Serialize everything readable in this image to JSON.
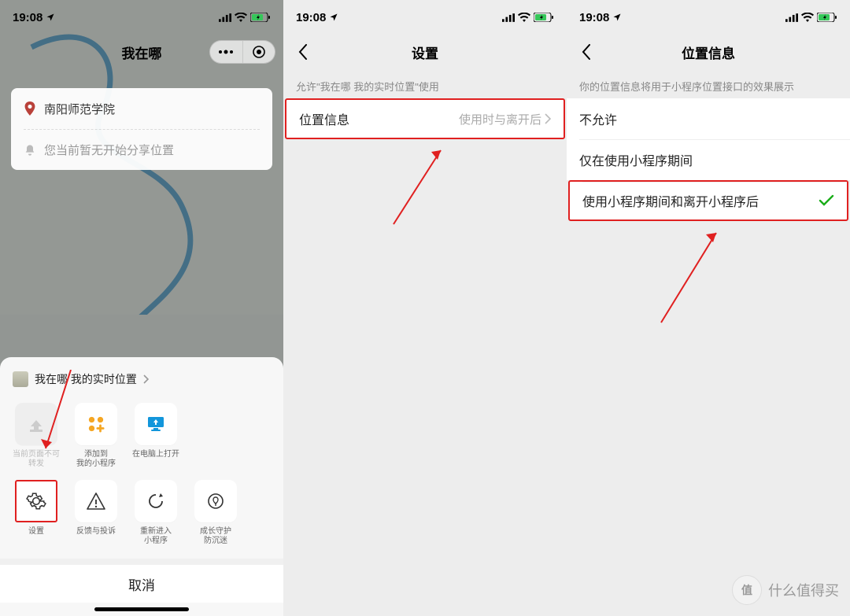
{
  "status": {
    "time": "19:08",
    "battery_charging": true
  },
  "screen1": {
    "title": "我在哪",
    "location_card": {
      "place": "南阳师范学院",
      "share_hint": "您当前暂无开始分享位置"
    },
    "sheet": {
      "title": "我在哪 我的实时位置",
      "row1": [
        {
          "label": "当前页面不可\n转发",
          "disabled": true,
          "icon": "share"
        },
        {
          "label": "添加到\n我的小程序",
          "icon": "add-mini"
        },
        {
          "label": "在电脑上打开",
          "icon": "open-pc"
        }
      ],
      "row2": [
        {
          "label": "设置",
          "icon": "settings",
          "highlight": true
        },
        {
          "label": "反馈与投诉",
          "icon": "feedback"
        },
        {
          "label": "重新进入\n小程序",
          "icon": "restart"
        },
        {
          "label": "成长守护\n防沉迷",
          "icon": "guard"
        }
      ],
      "cancel": "取消"
    }
  },
  "screen2": {
    "title": "设置",
    "section_hint": "允许\"我在哪 我的实时位置\"使用",
    "cell_label": "位置信息",
    "cell_value": "使用时与离开后"
  },
  "screen3": {
    "title": "位置信息",
    "section_hint": "你的位置信息将用于小程序位置接口的效果展示",
    "options": [
      {
        "label": "不允许",
        "selected": false,
        "highlight": false
      },
      {
        "label": "仅在使用小程序期间",
        "selected": false,
        "highlight": false
      },
      {
        "label": "使用小程序期间和离开小程序后",
        "selected": true,
        "highlight": true
      }
    ]
  },
  "watermark": "什么值得买"
}
